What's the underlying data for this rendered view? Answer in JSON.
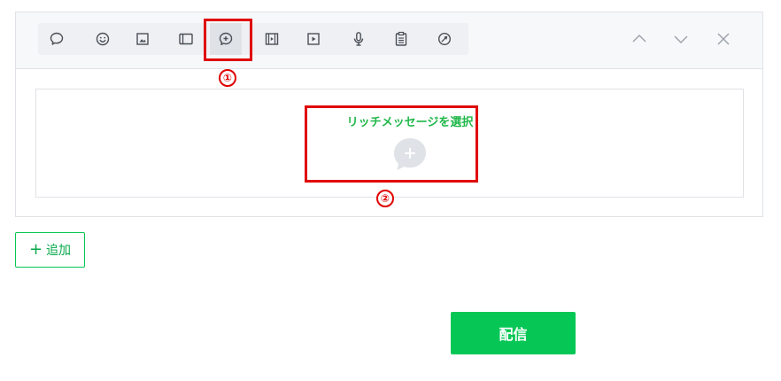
{
  "toolbar": {
    "tools": [
      {
        "icon": "speech-bubble-icon"
      },
      {
        "icon": "smiley-icon"
      },
      {
        "icon": "image-icon"
      },
      {
        "icon": "card-icon"
      },
      {
        "icon": "rich-message-icon",
        "active": true
      },
      {
        "icon": "video-film-icon"
      },
      {
        "icon": "play-icon"
      },
      {
        "icon": "microphone-icon"
      },
      {
        "icon": "clipboard-icon"
      },
      {
        "icon": "coupon-icon"
      }
    ],
    "nav": [
      {
        "icon": "chevron-up-icon"
      },
      {
        "icon": "chevron-down-icon"
      },
      {
        "icon": "close-icon"
      }
    ]
  },
  "content": {
    "select_label": "リッチメッセージを選択"
  },
  "annotations": {
    "marker_1": "①",
    "marker_2": "②"
  },
  "actions": {
    "add_plus": "+",
    "add_label": "追加",
    "send_label": "配信"
  },
  "colors": {
    "accent_green": "#06c755",
    "annotation_red": "#e00000",
    "icon_gray": "#4a4f57"
  }
}
